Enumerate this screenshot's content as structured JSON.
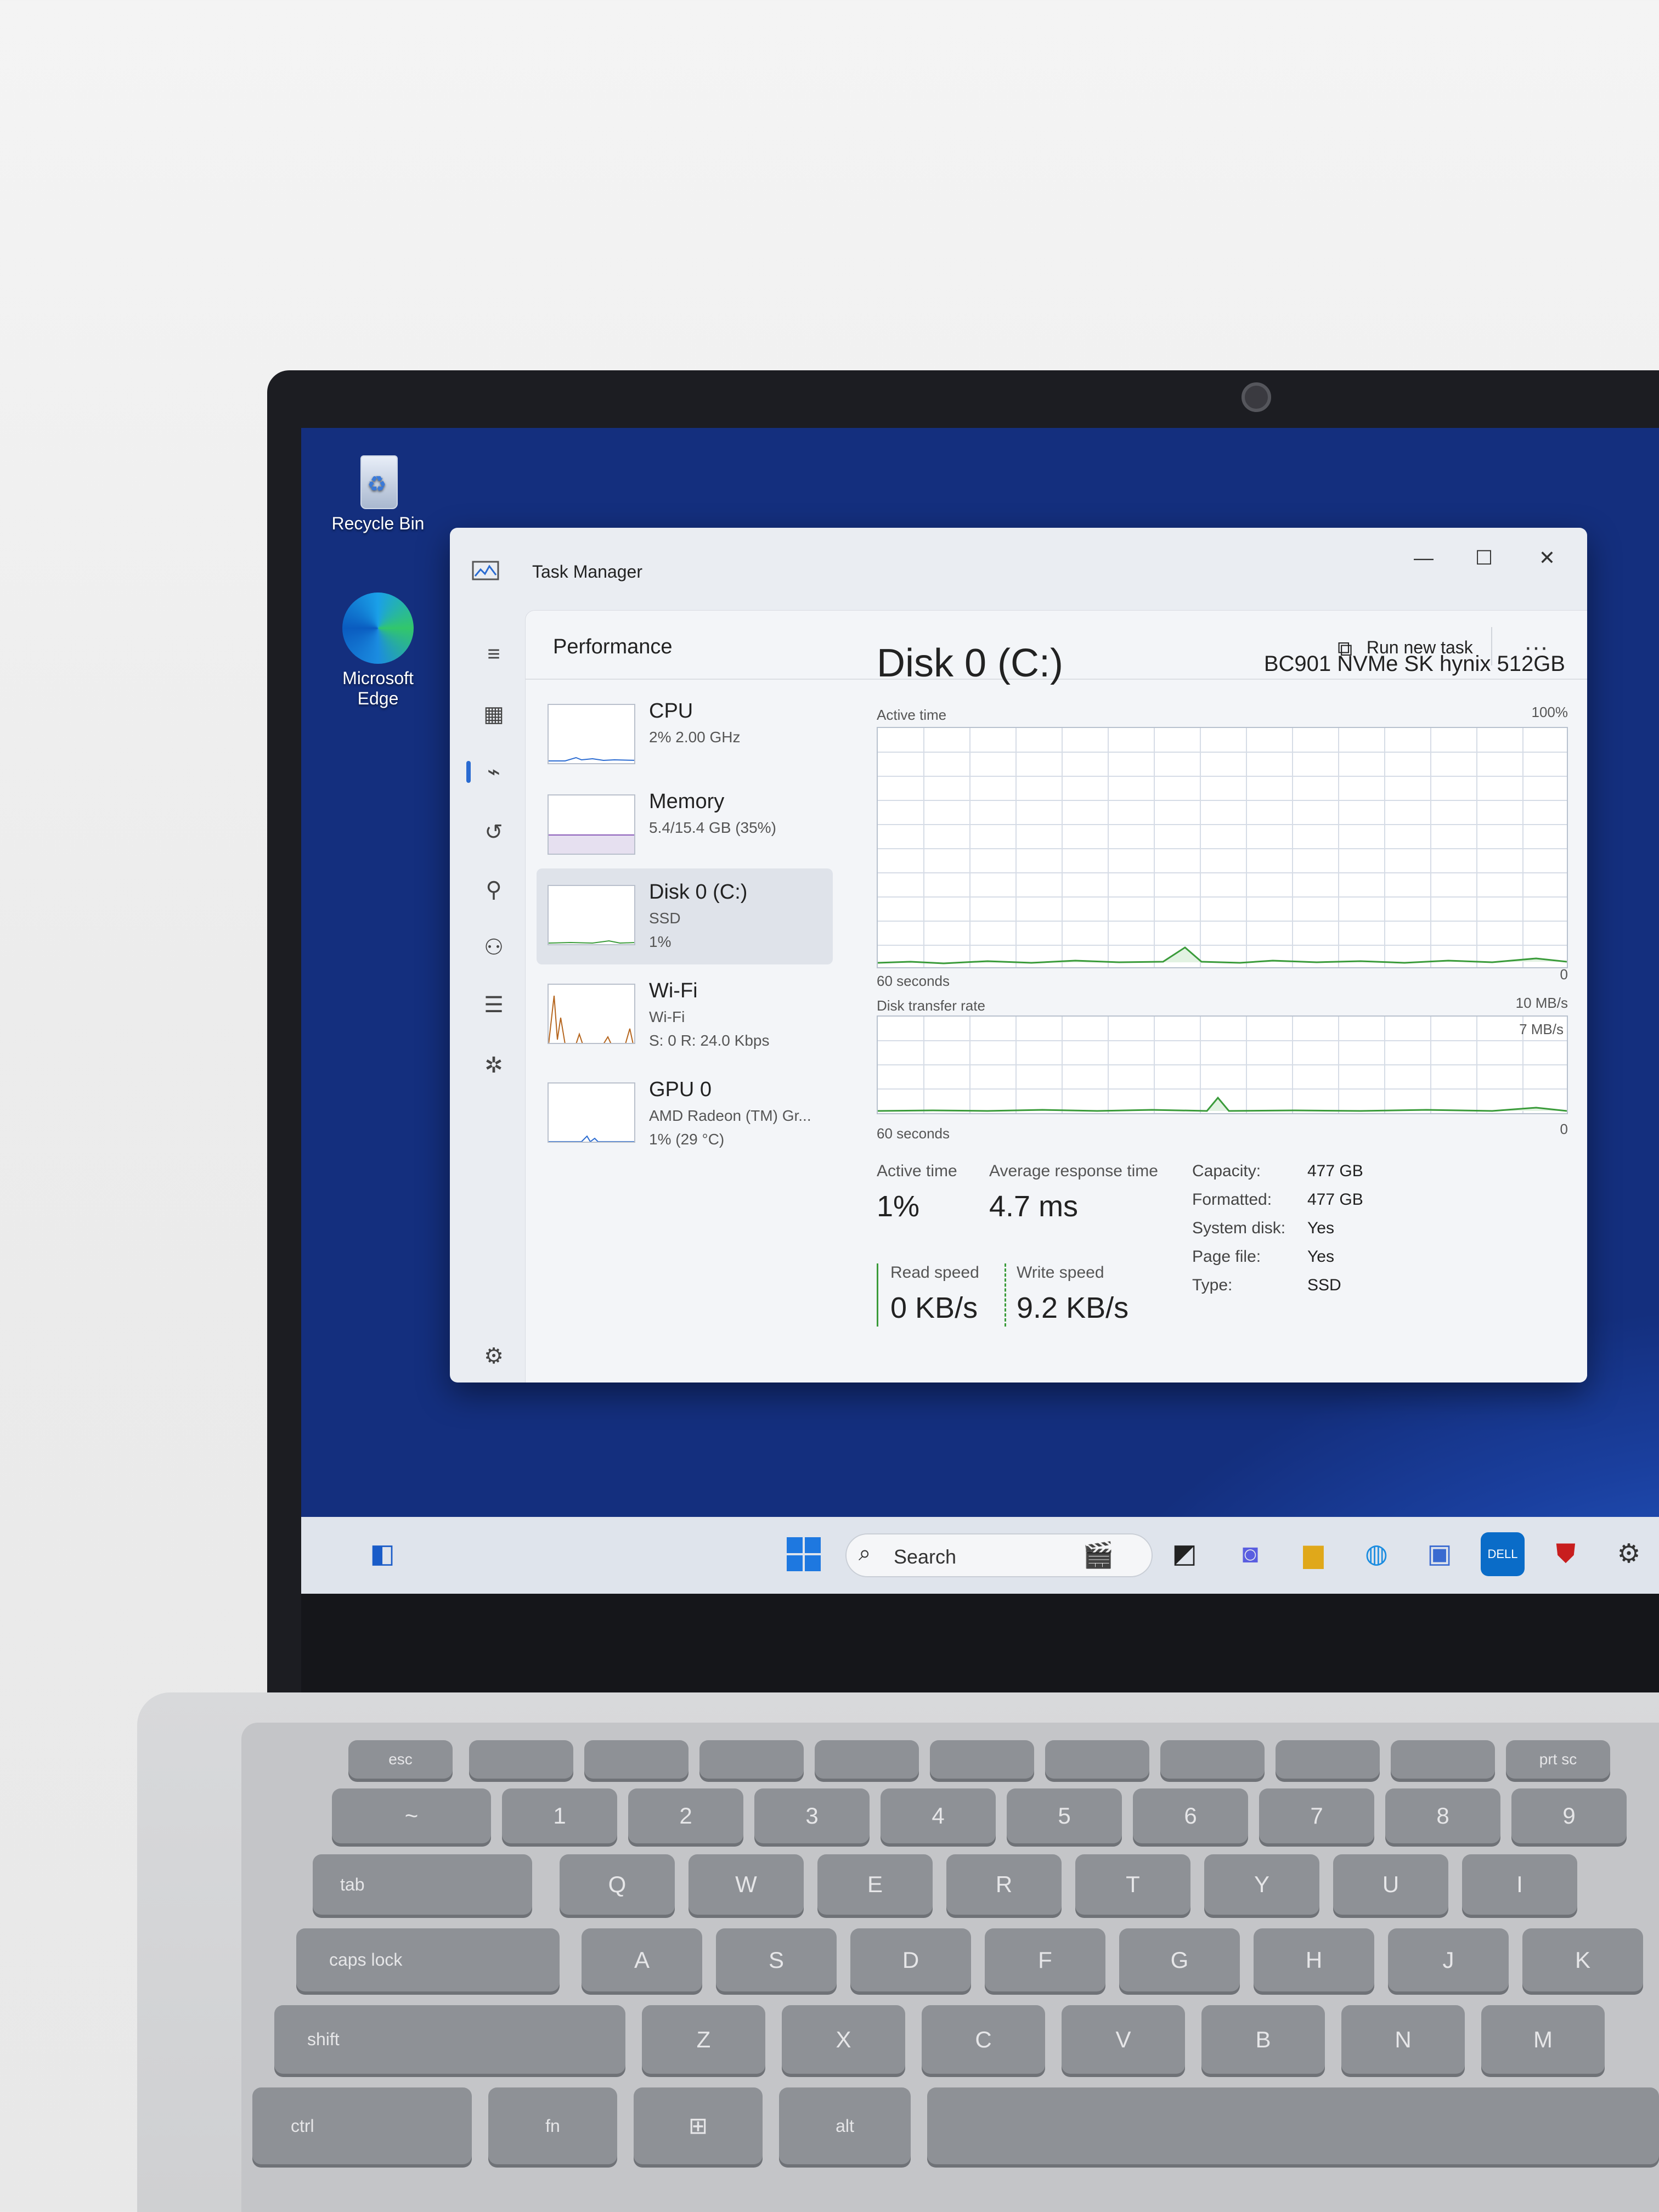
{
  "desktop": {
    "icons": [
      {
        "label": "Recycle Bin"
      },
      {
        "label_line1": "Microsoft",
        "label_line2": "Edge"
      }
    ]
  },
  "window": {
    "title": "Task Manager",
    "controls": {
      "minimize": "—",
      "maximize": "☐",
      "close": "✕"
    }
  },
  "header": {
    "page_title": "Performance",
    "run_new_task": "Run new task",
    "more": "···"
  },
  "sidebar": {
    "items": [
      {
        "title": "CPU",
        "sub1": "2% 2.00 GHz",
        "sub2": ""
      },
      {
        "title": "Memory",
        "sub1": "5.4/15.4 GB (35%)",
        "sub2": ""
      },
      {
        "title": "Disk 0 (C:)",
        "sub1": "SSD",
        "sub2": "1%"
      },
      {
        "title": "Wi-Fi",
        "sub1": "Wi-Fi",
        "sub2": "S: 0 R: 24.0 Kbps"
      },
      {
        "title": "GPU 0",
        "sub1": "AMD Radeon (TM) Gr...",
        "sub2": "1% (29 °C)"
      }
    ]
  },
  "detail": {
    "title": "Disk 0 (C:)",
    "model": "BC901 NVMe SK hynix 512GB",
    "active_time_graph": {
      "label": "Active time",
      "max": "100%",
      "min": "0",
      "span": "60 seconds"
    },
    "transfer_graph": {
      "label": "Disk transfer rate",
      "max": "10 MB/s",
      "inner": "7 MB/s",
      "min": "0",
      "span": "60 seconds"
    },
    "stats": {
      "active_time_label": "Active time",
      "active_time_value": "1%",
      "avg_resp_label": "Average response time",
      "avg_resp_value": "4.7 ms",
      "read_label": "Read speed",
      "read_value": "0 KB/s",
      "write_label": "Write speed",
      "write_value": "9.2 KB/s"
    },
    "props": [
      {
        "label": "Capacity:",
        "value": "477 GB"
      },
      {
        "label": "Formatted:",
        "value": "477 GB"
      },
      {
        "label": "System disk:",
        "value": "Yes"
      },
      {
        "label": "Page file:",
        "value": "Yes"
      },
      {
        "label": "Type:",
        "value": "SSD"
      }
    ]
  },
  "taskbar": {
    "search_placeholder": "Search"
  },
  "keyboard": {
    "fn_row": [
      "esc",
      "",
      "",
      "",
      "",
      "",
      "",
      "",
      "",
      "",
      "prt sc"
    ],
    "num_row": [
      "~",
      "1",
      "2",
      "3",
      "4",
      "5",
      "6",
      "7",
      "8",
      "9"
    ],
    "q_row": [
      "tab",
      "Q",
      "W",
      "E",
      "R",
      "T",
      "Y",
      "U",
      "I"
    ],
    "a_row": [
      "caps lock",
      "A",
      "S",
      "D",
      "F",
      "G",
      "H",
      "J",
      "K"
    ],
    "z_row": [
      "shift",
      "Z",
      "X",
      "C",
      "V",
      "B",
      "N",
      "M"
    ],
    "bottom_row": [
      "ctrl",
      "fn",
      "",
      "alt"
    ]
  }
}
